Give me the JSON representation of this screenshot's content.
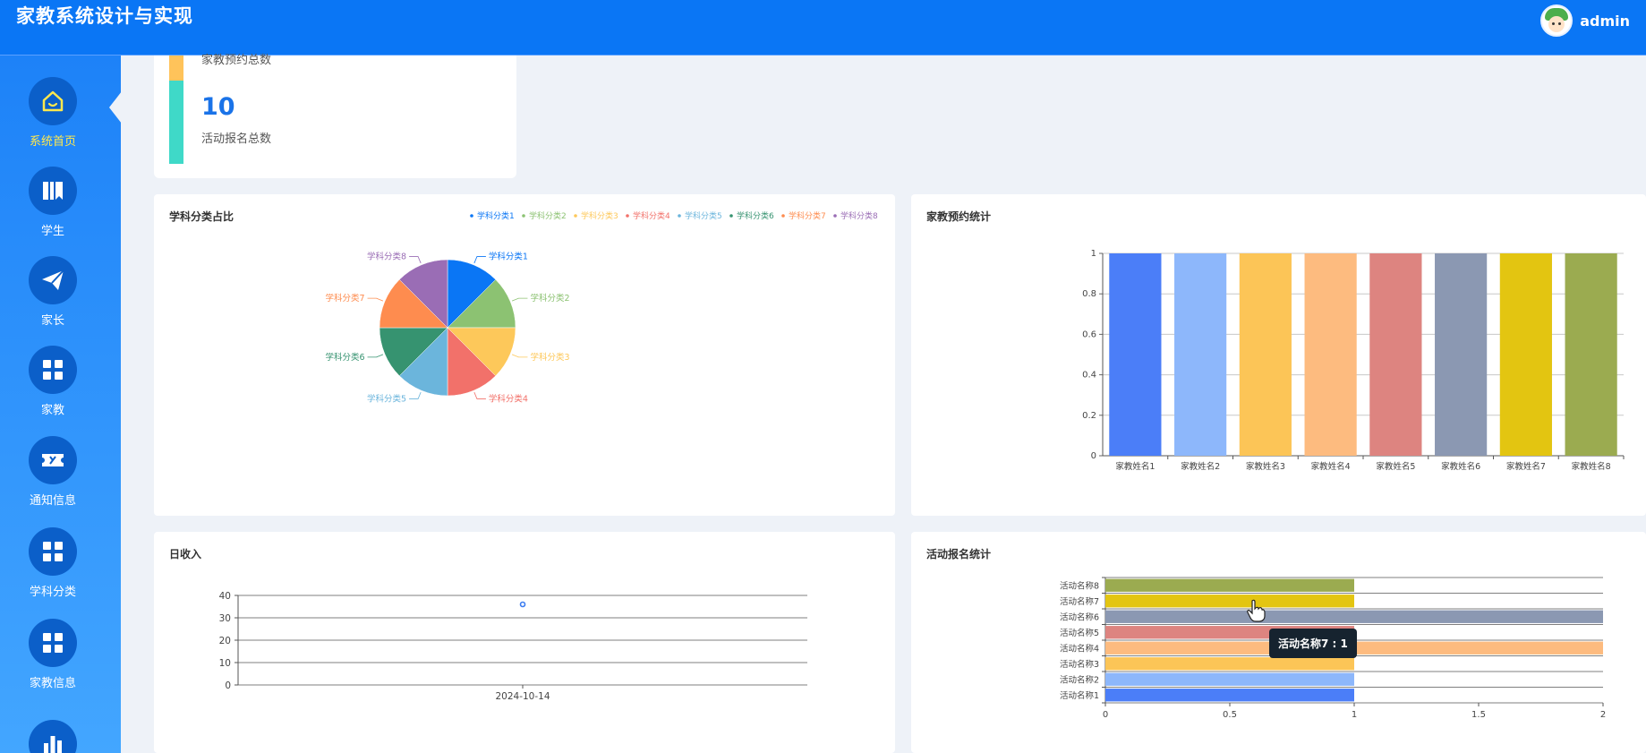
{
  "header": {
    "title": "家教系统设计与实现",
    "username": "admin"
  },
  "sidebar": {
    "items": [
      {
        "label": "系统首页",
        "icon": "home-icon",
        "active": true
      },
      {
        "label": "学生",
        "icon": "book-icon",
        "active": false
      },
      {
        "label": "家长",
        "icon": "paper-plane-icon",
        "active": false
      },
      {
        "label": "家教",
        "icon": "grid-icon",
        "active": false
      },
      {
        "label": "通知信息",
        "icon": "ticket-icon",
        "active": false
      },
      {
        "label": "学科分类",
        "icon": "grid-icon",
        "active": false
      },
      {
        "label": "家教信息",
        "icon": "grid-icon",
        "active": false
      },
      {
        "label": "",
        "icon": "bar-chart-icon",
        "active": false
      }
    ]
  },
  "stats": {
    "cut_label": "家教预约总数",
    "value": "10",
    "label": "活动报名总数"
  },
  "panels": {
    "pie_title": "学科分类占比",
    "bar_title": "家教预约统计",
    "line_title": "日收入",
    "hbar_title": "活动报名统计"
  },
  "tooltip": "活动名称7 : 1",
  "colors": {
    "header": "#0a76f5",
    "sidebar_active_label": "#ffe84d",
    "stat_accent_top": "#ffc35a",
    "stat_accent_bottom": "#3fd9c8"
  },
  "chart_data": [
    {
      "type": "pie",
      "title": "学科分类占比",
      "legend_position": "top-right",
      "categories": [
        "学科分类1",
        "学科分类2",
        "学科分类3",
        "学科分类4",
        "学科分类5",
        "学科分类6",
        "学科分类7",
        "学科分类8"
      ],
      "values": [
        1,
        1,
        1,
        1,
        1,
        1,
        1,
        1
      ],
      "colors": [
        "#0a76f5",
        "#8cc272",
        "#fdc85a",
        "#f2716a",
        "#6bb5dc",
        "#369370",
        "#fe8c4f",
        "#9a6db5"
      ]
    },
    {
      "type": "bar",
      "title": "家教预约统计",
      "categories": [
        "家教姓名1",
        "家教姓名2",
        "家教姓名3",
        "家教姓名4",
        "家教姓名5",
        "家教姓名6",
        "家教姓名7",
        "家教姓名8"
      ],
      "values": [
        1,
        1,
        1,
        1,
        1,
        1,
        1,
        1
      ],
      "ylim": [
        0,
        1
      ],
      "yticks": [
        "0",
        "0.2",
        "0.4",
        "0.6",
        "0.8",
        "1"
      ],
      "colors": [
        "#4b7ef8",
        "#8db7fb",
        "#fcc557",
        "#fdbb7f",
        "#dd8480",
        "#8b98b2",
        "#e3c511",
        "#9bab50"
      ],
      "grid": true
    },
    {
      "type": "scatter",
      "title": "日收入",
      "x": [
        "2024-10-14"
      ],
      "values": [
        36
      ],
      "ylim": [
        0,
        40
      ],
      "yticks": [
        "0",
        "10",
        "20",
        "30",
        "40"
      ],
      "grid": true
    },
    {
      "type": "bar",
      "orientation": "horizontal",
      "title": "活动报名统计",
      "categories": [
        "活动名称1",
        "活动名称2",
        "活动名称3",
        "活动名称4",
        "活动名称5",
        "活动名称6",
        "活动名称7",
        "活动名称8"
      ],
      "values": [
        1,
        1,
        1,
        2,
        1,
        2,
        1,
        1
      ],
      "xlim": [
        0,
        2
      ],
      "xticks": [
        "0",
        "0.5",
        "1",
        "1.5",
        "2"
      ],
      "colors": [
        "#4b7ef8",
        "#8db7fb",
        "#fcc557",
        "#fdbb7f",
        "#dd8480",
        "#8b98b2",
        "#e3c511",
        "#9bab50"
      ],
      "grid": true
    }
  ]
}
